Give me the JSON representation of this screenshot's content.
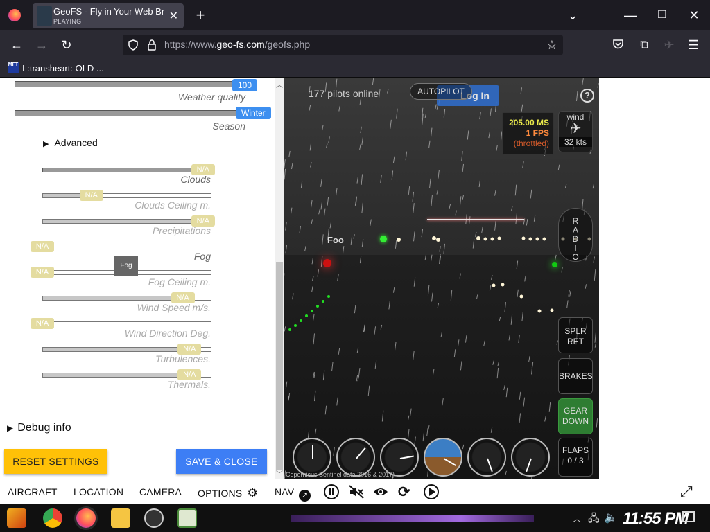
{
  "browser": {
    "tab": {
      "title": "GeoFS - Fly in Your Web Bro",
      "status": "PLAYING"
    },
    "url_prefix": "https://www.",
    "url_domain": "geo-fs.com",
    "url_path": "/geofs.php",
    "bookmark_icon_text": "MFT",
    "bookmark_label": "I :transheart: OLD ..."
  },
  "settings": {
    "weather_quality": {
      "label": "Weather quality",
      "value": "100",
      "level": 1.0
    },
    "season": {
      "label": "Season",
      "value": "Winter",
      "level": 1.0
    },
    "advanced_label": "Advanced",
    "sliders": [
      {
        "label": "Clouds",
        "value": "N/A",
        "level": 0.95
      },
      {
        "label": "Clouds Ceiling m.",
        "value": "N/A",
        "level": 0.29
      },
      {
        "label": "Precipitations",
        "value": "N/A",
        "level": 0.95
      },
      {
        "label": "Fog",
        "value": "N/A",
        "level": 0.0
      },
      {
        "label": "Fog Ceiling m.",
        "value": "N/A",
        "level": 0.0,
        "tooltip": "Fog"
      },
      {
        "label": "Wind Speed m/s.",
        "value": "N/A",
        "level": 0.83
      },
      {
        "label": "Wind Direction Deg.",
        "value": "N/A",
        "level": 0.0
      },
      {
        "label": "Turbulences.",
        "value": "N/A",
        "level": 0.87
      },
      {
        "label": "Thermals.",
        "value": "N/A",
        "level": 0.87
      }
    ],
    "debug_label": "Debug info",
    "reset_label": "RESET SETTINGS",
    "save_label": "SAVE & CLOSE"
  },
  "game": {
    "pilots_online": "177 pilots online",
    "autopilot_label": "AUTOPILOT",
    "login_label": "Log In",
    "help_label": "?",
    "stats": {
      "ms": "205.00 MS",
      "fps": "1 FPS",
      "throttled": "(throttled)"
    },
    "wind": {
      "label": "wind",
      "speed": "32 kts"
    },
    "radio_label": "RADIO",
    "spoiler_label_1": "SPLR",
    "spoiler_label_2": "RET",
    "brakes_label": "BRAKES",
    "gear_label_1": "GEAR",
    "gear_label_2": "DOWN",
    "flaps_label": "FLAPS",
    "flaps_value": "0 / 3",
    "ground_text": "Foo",
    "attribution": "Copernicus Sentinel data 2016 & 2017)"
  },
  "bottom_menu": {
    "aircraft": "AIRCRAFT",
    "location": "LOCATION",
    "camera": "CAMERA",
    "options": "OPTIONS",
    "nav": "NAV"
  },
  "taskbar": {
    "clock": "11:55 PM"
  },
  "colors": {
    "accent_blue": "#3d8ff0",
    "na_yellow": "#e4dca0",
    "reset_yellow": "#ffc107",
    "save_blue": "#3d7ef5",
    "hud_yellow": "#e8e84a",
    "hud_orange": "#ff8a3d",
    "gear_green": "#2e7d32"
  }
}
